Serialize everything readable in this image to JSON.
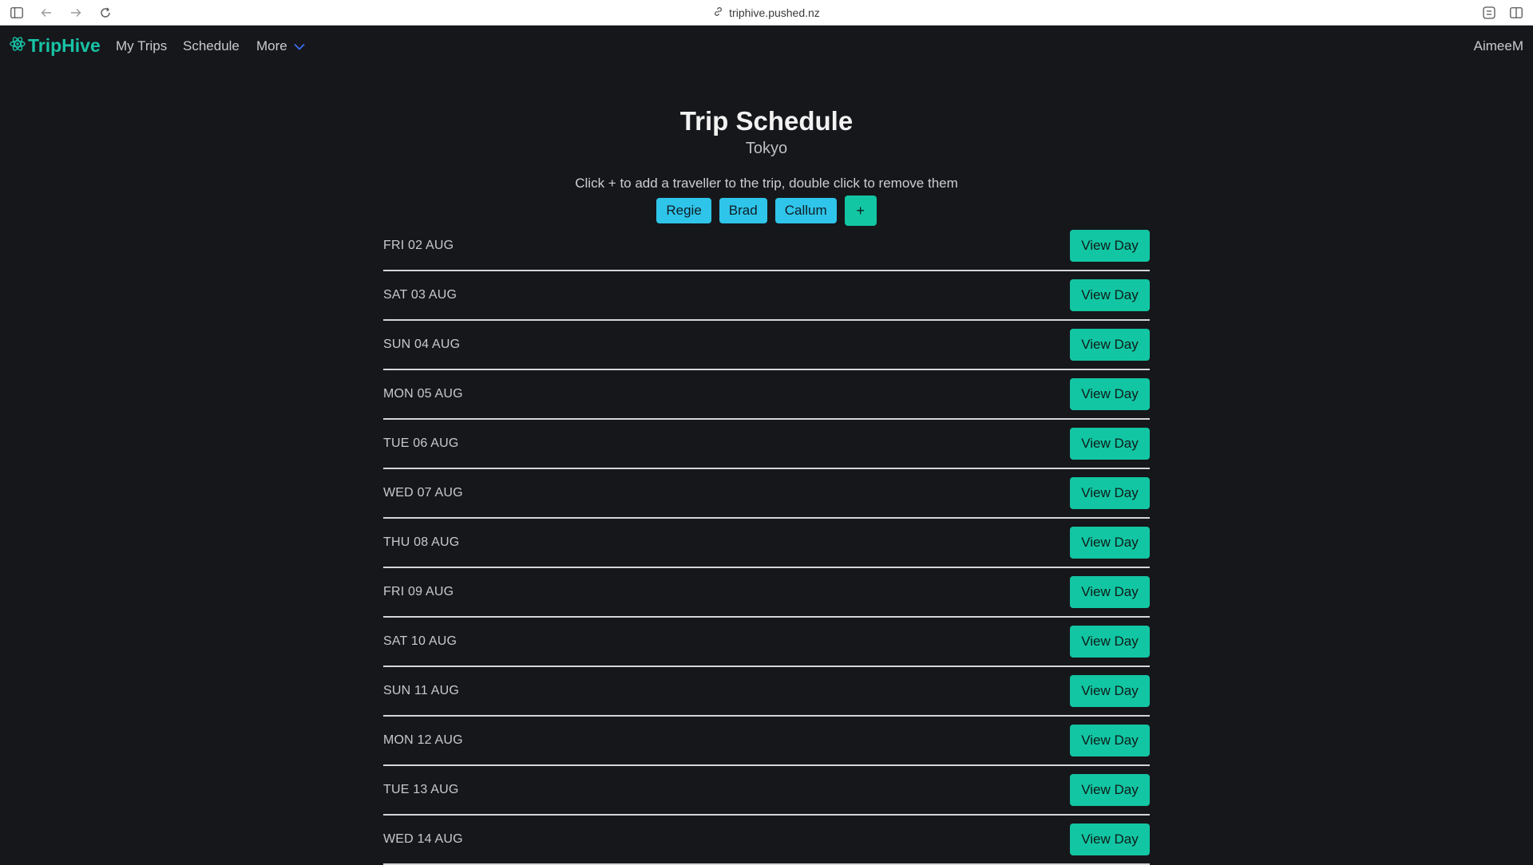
{
  "browser": {
    "url": "triphive.pushed.nz"
  },
  "nav": {
    "brand": "TripHive",
    "links": [
      "My Trips",
      "Schedule"
    ],
    "more_label": "More",
    "user": "AimeeM"
  },
  "header": {
    "title": "Trip Schedule",
    "subtitle": "Tokyo",
    "hint": "Click + to add a traveller to the trip, double click to remove them"
  },
  "travellers": [
    "Regie",
    "Brad",
    "Callum"
  ],
  "add_label": "+",
  "view_label": "View Day",
  "days": [
    "FRI 02 AUG",
    "SAT 03 AUG",
    "SUN 04 AUG",
    "MON 05 AUG",
    "TUE 06 AUG",
    "WED 07 AUG",
    "THU 08 AUG",
    "FRI 09 AUG",
    "SAT 10 AUG",
    "SUN 11 AUG",
    "MON 12 AUG",
    "TUE 13 AUG",
    "WED 14 AUG"
  ],
  "colors": {
    "background": "#16171b",
    "accent": "#12c6a3",
    "chip": "#2fc5ea"
  }
}
